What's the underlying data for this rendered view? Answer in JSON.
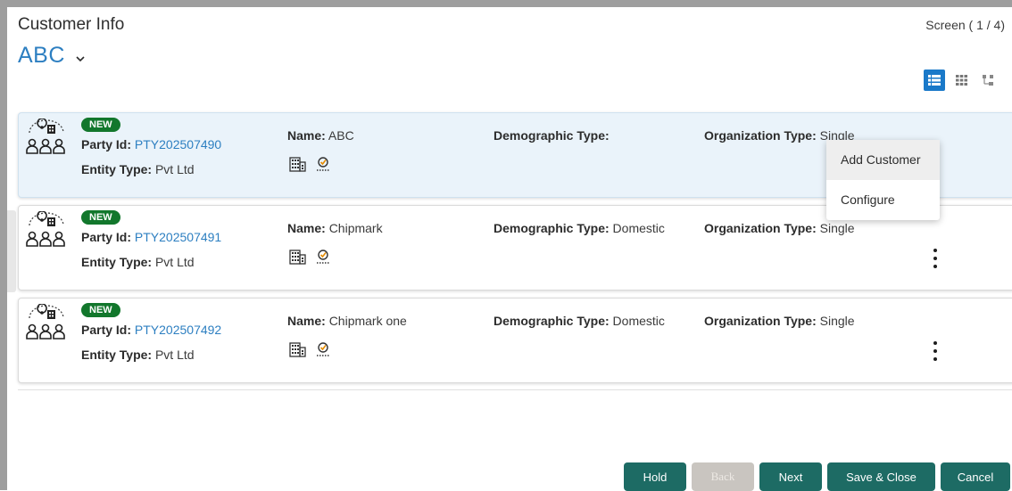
{
  "header": {
    "title": "Customer Info",
    "screen_counter": "Screen ( 1 / 4)"
  },
  "customer_select": {
    "value": "ABC"
  },
  "view_options": [
    "list-view-icon",
    "grid-view-icon",
    "tree-view-icon"
  ],
  "cards": [
    {
      "status": "NEW",
      "party_id_label": "Party Id:",
      "party_id": "PTY202507490",
      "entity_label": "Entity Type:",
      "entity_type": "Pvt Ltd",
      "name_label": "Name:",
      "name": "ABC",
      "demographic_label": "Demographic Type:",
      "demographic_type": "",
      "org_label": "Organization Type:",
      "org_type": "Single"
    },
    {
      "status": "NEW",
      "party_id_label": "Party Id:",
      "party_id": "PTY202507491",
      "entity_label": "Entity Type:",
      "entity_type": "Pvt Ltd",
      "name_label": "Name:",
      "name": "Chipmark",
      "demographic_label": "Demographic Type:",
      "demographic_type": "Domestic",
      "org_label": "Organization Type:",
      "org_type": "Single"
    },
    {
      "status": "NEW",
      "party_id_label": "Party Id:",
      "party_id": "PTY202507492",
      "entity_label": "Entity Type:",
      "entity_type": "Pvt Ltd",
      "name_label": "Name:",
      "name": "Chipmark one",
      "demographic_label": "Demographic Type:",
      "demographic_type": "Domestic",
      "org_label": "Organization Type:",
      "org_type": "Single"
    }
  ],
  "context_menu": {
    "items": [
      "Add Customer",
      "Configure"
    ]
  },
  "footer": {
    "hold": "Hold",
    "back": "Back",
    "next": "Next",
    "save_close": "Save & Close",
    "cancel": "Cancel"
  },
  "colors": {
    "accent": "#2d7fc1",
    "badge": "#12772c",
    "button": "#1d6b64",
    "button_disabled": "#c9c5c0",
    "selected_card": "#eaf3fa"
  }
}
